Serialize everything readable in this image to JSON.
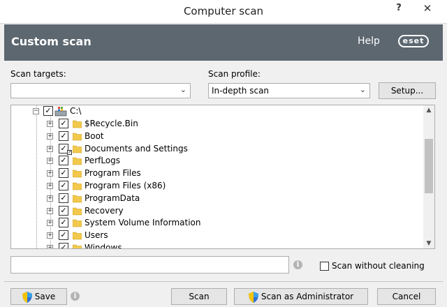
{
  "window": {
    "title": "Computer scan",
    "help_glyph": "?",
    "close_glyph": "✕"
  },
  "header": {
    "title": "Custom scan",
    "help": "Help",
    "logo": "eset"
  },
  "scan_targets": {
    "label": "Scan targets:",
    "value": ""
  },
  "scan_profile": {
    "label": "Scan profile:",
    "value": "In-depth scan",
    "setup_label": "Setup..."
  },
  "tree": {
    "root": {
      "label": "C:\\",
      "checked": true
    },
    "items": [
      {
        "label": "$Recycle.Bin"
      },
      {
        "label": "Boot"
      },
      {
        "label": "Documents and Settings"
      },
      {
        "label": "PerfLogs"
      },
      {
        "label": "Program Files"
      },
      {
        "label": "Program Files (x86)"
      },
      {
        "label": "ProgramData"
      },
      {
        "label": "Recovery"
      },
      {
        "label": "System Volume Information"
      },
      {
        "label": "Users"
      },
      {
        "label": "Windows"
      }
    ]
  },
  "path_input": {
    "value": ""
  },
  "options": {
    "scan_without_cleaning": "Scan without cleaning"
  },
  "buttons": {
    "save": "Save",
    "scan": "Scan",
    "scan_as_admin": "Scan as Administrator",
    "cancel": "Cancel"
  },
  "colors": {
    "header_bg": "#5c6770",
    "folder": "#f2c94c"
  }
}
